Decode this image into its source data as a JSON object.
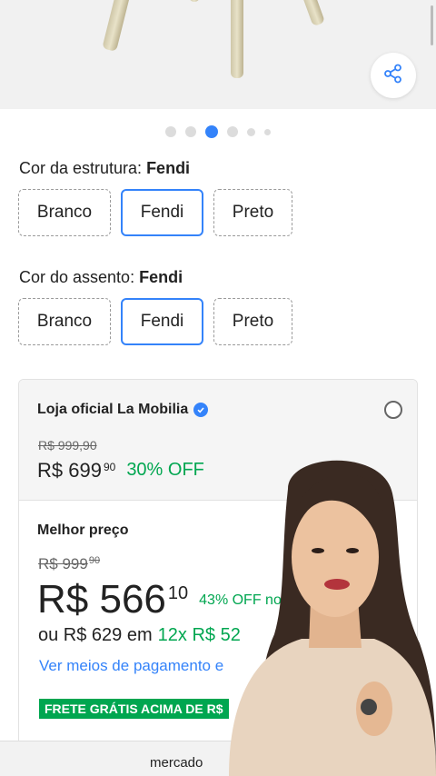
{
  "gallery": {
    "active_index": 3,
    "total": 6
  },
  "frame_color": {
    "label": "Cor da estrutura: ",
    "selected": "Fendi",
    "options": [
      "Branco",
      "Fendi",
      "Preto"
    ]
  },
  "seat_color": {
    "label": "Cor do assento: ",
    "selected": "Fendi",
    "options": [
      "Branco",
      "Fendi",
      "Preto"
    ]
  },
  "offer_store": {
    "store_name": "Loja oficial La Mobilia",
    "old_price": "R$ 999,90",
    "price_prefix": "R$ 699",
    "price_cents": "90",
    "discount": "30% OFF"
  },
  "offer_best": {
    "label": "Melhor preço",
    "old_price_main": "R$ 999",
    "old_price_cents": "90",
    "price_prefix": "R$ 566",
    "price_cents": "10",
    "discount": "43% OFF no",
    "installments": "ou R$ 629 em",
    "installments_highlight": "12x R$ 52",
    "payment_link": "Ver meios de pagamento e",
    "free_shipping": "FRETE GRÁTIS ACIMA DE R$"
  },
  "browser": {
    "url_text": "mercado"
  },
  "colors": {
    "accent": "#3483fa",
    "green": "#00a650"
  },
  "icons": [
    "share-icon",
    "verified-icon"
  ]
}
